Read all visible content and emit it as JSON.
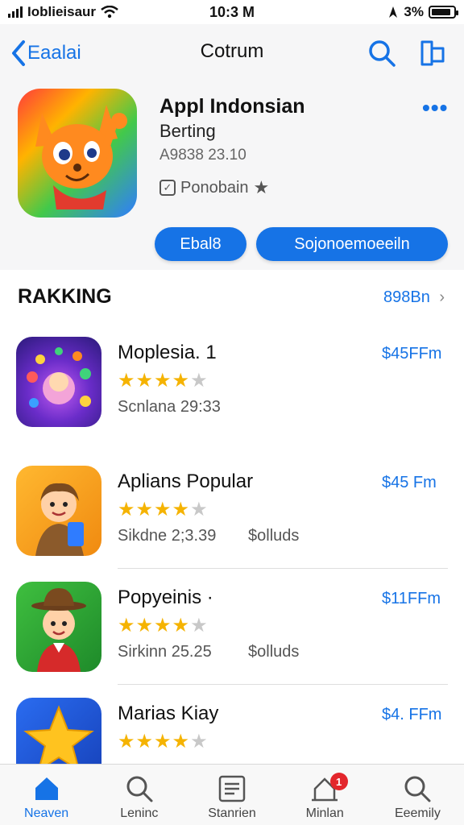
{
  "status_bar": {
    "carrier": "Ioblieisaur",
    "time": "10:3 M",
    "battery": "3%",
    "battery_level": 0.9
  },
  "nav": {
    "back_label": "Eaalai",
    "title": "Cotrum"
  },
  "app": {
    "name": "Appl Indonsian",
    "subtitle": "Berting",
    "meta": "A9838 23.10",
    "category": "Ponobain",
    "primary_button": "Ebal8",
    "secondary_button": "Sojonoemoeeiln"
  },
  "section": {
    "title": "RAKKING",
    "link": "898Bn"
  },
  "items": [
    {
      "name": "Moplesia. 1",
      "sub": "Scnlana 29:33",
      "sub2": "",
      "price": "$45FFm",
      "rating": 4
    },
    {
      "name": "Aplians Popular",
      "sub": "Sikdne 2;3.39",
      "sub2": "$olluds",
      "price": "$45 Fm",
      "rating": 4
    },
    {
      "name": "Popyeinis ·",
      "sub": "Sirkinn 25.25",
      "sub2": "$olluds",
      "price": "$11FFm",
      "rating": 4
    },
    {
      "name": "Marias Kiay",
      "sub": "",
      "sub2": "",
      "price": "$4. FFm",
      "rating": 4
    }
  ],
  "tabs": [
    {
      "label": "Neaven",
      "icon": "home-icon",
      "active": true
    },
    {
      "label": "Leninc",
      "icon": "search-icon",
      "active": false
    },
    {
      "label": "Stanrien",
      "icon": "list-icon",
      "active": false
    },
    {
      "label": "Minlan",
      "icon": "updates-icon",
      "active": false,
      "badge": "1"
    },
    {
      "label": "Eeemily",
      "icon": "search-icon",
      "active": false
    }
  ],
  "colors": {
    "accent": "#1673e6",
    "star": "#f5b301",
    "badge": "#e3262c"
  }
}
